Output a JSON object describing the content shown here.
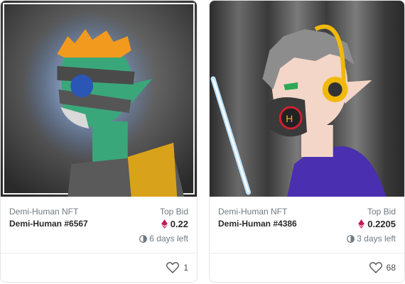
{
  "cards": [
    {
      "collection": "Demi-Human NFT",
      "name": "Demi-Human #6567",
      "bid_label": "Top Bid",
      "bid_value": "0.22",
      "time_left": "6 days left",
      "likes": "1",
      "icons": [
        "ethereum-icon",
        "clock-icon",
        "heart-icon"
      ]
    },
    {
      "collection": "Demi-Human NFT",
      "name": "Demi-Human #4386",
      "bid_label": "Top Bid",
      "bid_value": "0.2205",
      "time_left": "3 days left",
      "likes": "68",
      "icons": [
        "ethereum-icon",
        "clock-icon",
        "heart-icon"
      ]
    }
  ],
  "colors": {
    "eth": "#c2185b",
    "muted_text": "#707a83",
    "title_text": "#2b2b2b"
  }
}
